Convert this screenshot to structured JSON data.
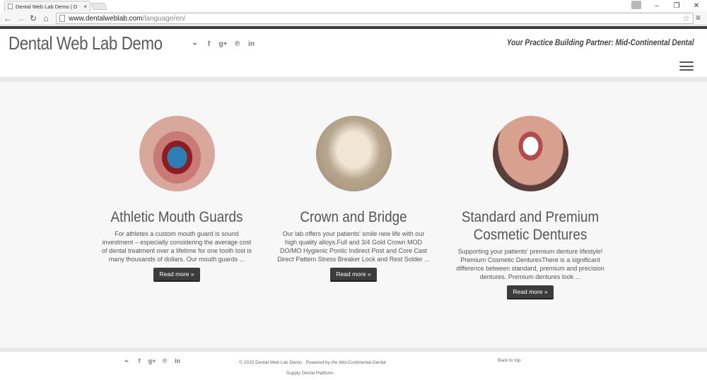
{
  "browser": {
    "tab_title": "Dental Web Lab Demo | D",
    "tab_close": "×",
    "url_host": "www.dentalweblab.com",
    "url_path": "/language/en/",
    "window_controls": [
      "–",
      "❐",
      "✕"
    ]
  },
  "site": {
    "brand": "Dental Web Lab Demo",
    "tagline": "Your Practice Building Partner: Mid-Continental Dental",
    "social_icons": [
      "rss-icon",
      "facebook-icon",
      "google-plus-icon",
      "pinterest-icon",
      "linkedin-icon"
    ],
    "social_glyphs": [
      "⌁",
      "f",
      "g+",
      "℗",
      "in"
    ]
  },
  "features": [
    {
      "title": "Athletic Mouth Guards",
      "text": "For athletes a custom mouth guard is sound investment – especially considering the average cost of dental treatment over a lifetime for one tooth lost is many thousands of dollars.  Our mouth guards ...",
      "button": "Read more »"
    },
    {
      "title": "Crown and Bridge",
      "text": "Our lab offers your patients' smile new life with our high quality alloys.Full and 3/4 Gold Crown MOD DO/MO Hygienic Pontic Indirect Post and Core Cast Direct Pattern Stress Breaker Lock and Rest Solder ...",
      "button": "Read more »"
    },
    {
      "title": "Standard and Premium Cosmetic Dentures",
      "text": "Supporting your patients' premium denture lifestyle!   Premium Cosmetic DenturesThere is a significant difference between standard, premium and precision dentures.  Premium dentures look ...",
      "button": "Read more »"
    }
  ],
  "footer": {
    "copyright": "· © 2015 Dental Web Lab Demo · Powered by the Mid-Continental Dental Supply Dental Platform ·",
    "back_to_top": "Back to top"
  },
  "colors": {
    "topbar": "#3b3b3b",
    "button": "#3c3c3c",
    "main_bg": "#f7f7f7"
  }
}
